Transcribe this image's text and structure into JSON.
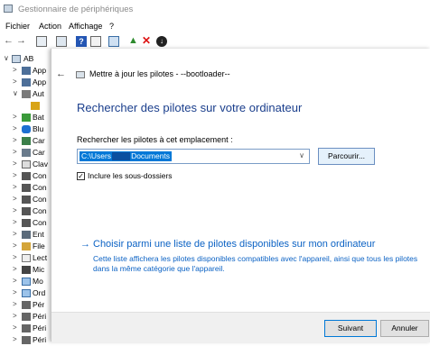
{
  "window": {
    "title": "Gestionnaire de périphériques"
  },
  "menu": [
    "Fichier",
    "Action",
    "Affichage",
    "?"
  ],
  "toolbar": {
    "icons": [
      "back-arrow-icon",
      "forward-arrow-icon",
      "properties-icon",
      "device-list-icon",
      "help-icon",
      "view-icon",
      "monitor-icon",
      "update-driver-icon",
      "uninstall-icon",
      "download-icon"
    ]
  },
  "tree": {
    "root": "AB",
    "items": [
      "App",
      "App",
      "Aut",
      "",
      "Bat",
      "Blu",
      "Car",
      "Car",
      "Clav",
      "Con",
      "Con",
      "Con",
      "Con",
      "Con",
      "Ent",
      "File",
      "Lect",
      "Mic",
      "Mo",
      "Ord",
      "Pér",
      "Péri",
      "Péri",
      "Péri"
    ]
  },
  "dialog": {
    "header_title": "Mettre à jour les pilotes - --bootloader--",
    "heading": "Rechercher des pilotes sur votre ordinateur",
    "search_label": "Rechercher les pilotes à cet emplacement :",
    "path_part1": "C:\\Users",
    "path_part2": "Documents",
    "browse_label": "Parcourir...",
    "include_subfolders": "Inclure les sous-dossiers",
    "include_checked": true,
    "choose_link": "Choisir parmi une liste de pilotes disponibles sur mon ordinateur",
    "choose_desc": "Cette liste affichera les pilotes disponibles compatibles avec l'appareil, ainsi que tous les pilotes dans la même catégorie que l'appareil.",
    "next_label": "Suivant",
    "cancel_label": "Annuler"
  },
  "colors": {
    "link": "#0b62c4",
    "heading": "#1a3e8c",
    "selection": "#0078d7"
  }
}
